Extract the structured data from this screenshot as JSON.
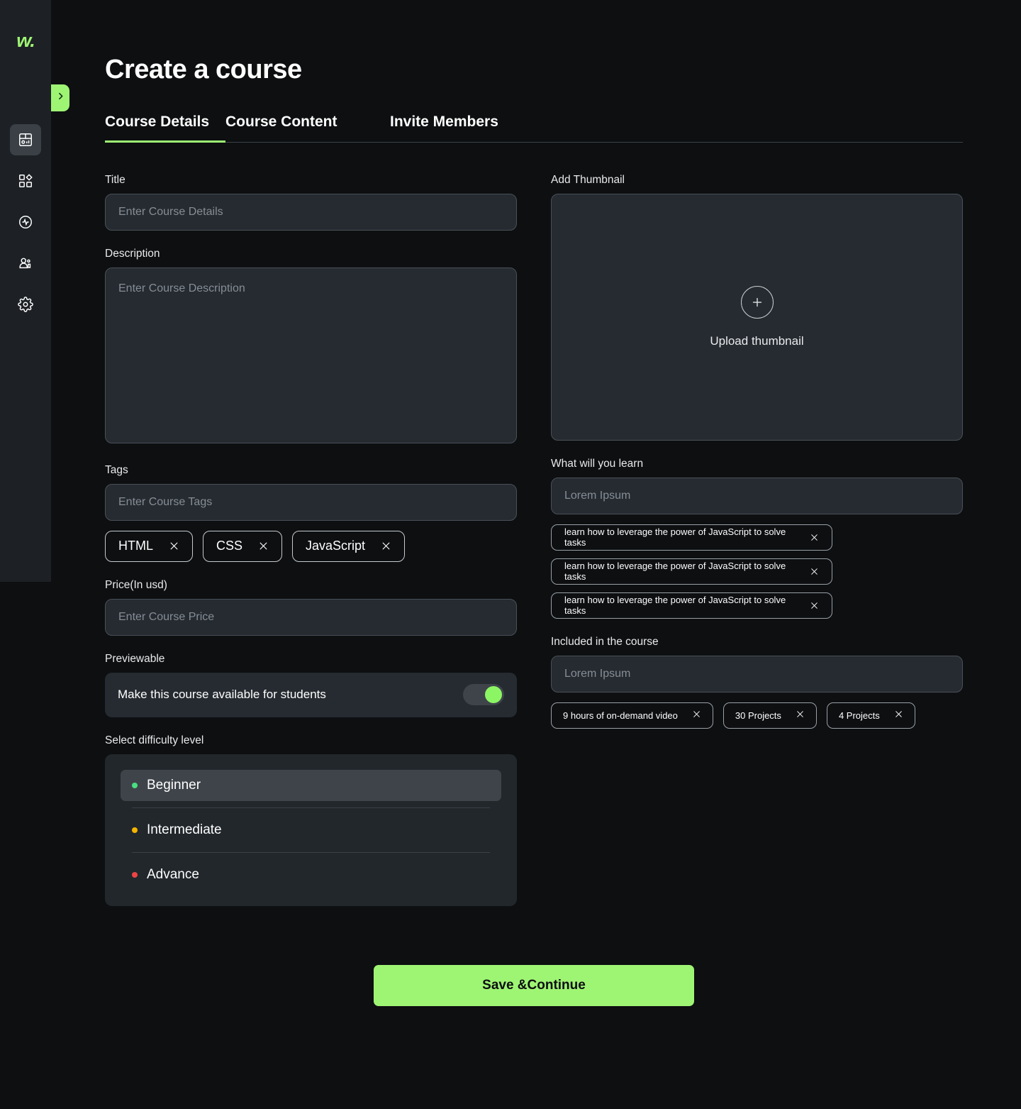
{
  "app": {
    "logo_text": "w.",
    "accent_color": "#9ef573",
    "background_color": "#0d0f11",
    "sidebar_color": "#1d2125",
    "input_color": "#262b31"
  },
  "sidebar": {
    "toggle_icon": "chevron-right-icon",
    "items": [
      {
        "icon": "dashboard-icon",
        "active": true
      },
      {
        "icon": "apps-grid-icon",
        "active": false
      },
      {
        "icon": "activity-pulse-icon",
        "active": false
      },
      {
        "icon": "users-icon",
        "active": false
      },
      {
        "icon": "settings-gear-icon",
        "active": false
      }
    ]
  },
  "header": {
    "title": "Create a course"
  },
  "tabs": [
    {
      "label": "Course Details",
      "active": true
    },
    {
      "label": "Course Content",
      "active": false
    },
    {
      "label": "Invite Members",
      "active": false
    }
  ],
  "left": {
    "title": {
      "label": "Title",
      "value": "",
      "placeholder": "Enter Course Details"
    },
    "description": {
      "label": "Description",
      "value": "",
      "placeholder": "Enter Course Description"
    },
    "tags": {
      "label": "Tags",
      "value": "",
      "placeholder": "Enter Course Tags",
      "chips": [
        "HTML",
        "CSS",
        "JavaScript"
      ]
    },
    "price": {
      "label": "Price(In usd)",
      "value": "",
      "placeholder": "Enter Course Price"
    },
    "previewable": {
      "label": "Previewable",
      "row_text": "Make this course available for students",
      "toggle_on": true
    },
    "difficulty": {
      "label": "Select difficulty level",
      "options": [
        {
          "label": "Beginner",
          "dot_color": "#4ade80",
          "selected": true
        },
        {
          "label": "Intermediate",
          "dot_color": "#f5b400",
          "selected": false
        },
        {
          "label": "Advance",
          "dot_color": "#ef4444",
          "selected": false
        }
      ]
    }
  },
  "right": {
    "thumbnail": {
      "label": "Add Thumbnail",
      "upload_text": "Upload thumbnail",
      "plus_icon": "plus-icon"
    },
    "learn": {
      "label": "What will you learn",
      "value": "",
      "placeholder": "Lorem Ipsum",
      "items": [
        "learn how to leverage the power of JavaScript to solve tasks",
        "learn how to leverage the power of JavaScript to solve tasks",
        "learn how to leverage the power of JavaScript to solve tasks"
      ]
    },
    "included": {
      "label": "Included in the course",
      "value": "",
      "placeholder": "Lorem Ipsum",
      "chips": [
        "9 hours of on-demand video",
        "30 Projects",
        "4 Projects"
      ]
    }
  },
  "footer": {
    "save_label": "Save &Continue"
  }
}
